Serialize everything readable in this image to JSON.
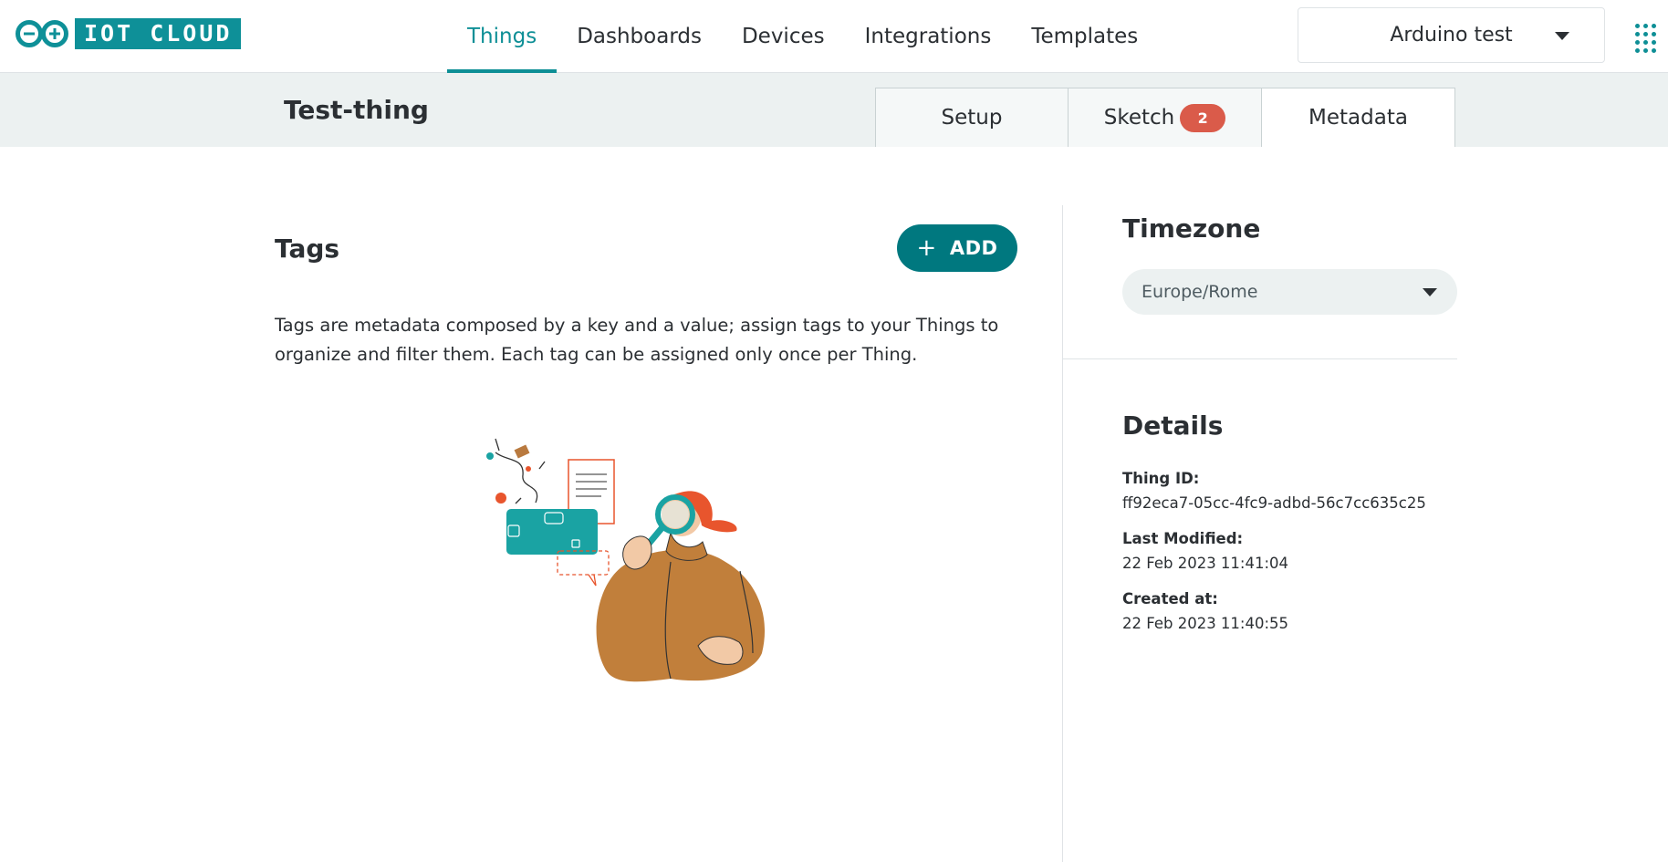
{
  "brand": {
    "name": "IOT CLOUD",
    "logo_icon": "arduino-infinity-icon",
    "color": "#0e9098"
  },
  "nav": {
    "items": [
      {
        "label": "Things",
        "active": true
      },
      {
        "label": "Dashboards",
        "active": false
      },
      {
        "label": "Devices",
        "active": false
      },
      {
        "label": "Integrations",
        "active": false
      },
      {
        "label": "Templates",
        "active": false
      }
    ],
    "accent": "#0e8f96"
  },
  "space_selector": {
    "value": "Arduino test",
    "icon": "chevron-down-icon"
  },
  "apps_menu_icon": "app-grid-icon",
  "thing": {
    "title": "Test-thing"
  },
  "tabs": [
    {
      "label": "Setup",
      "active": false
    },
    {
      "label": "Sketch",
      "active": false,
      "badge": "2"
    },
    {
      "label": "Metadata",
      "active": true
    }
  ],
  "tags": {
    "title": "Tags",
    "add_label": "ADD",
    "add_icon": "plus-icon",
    "description": "Tags are metadata composed by a key and a value; assign tags to your Things to organize and filter them. Each tag can be assigned only once per Thing.",
    "illustration": "person-with-magnifier-illustration"
  },
  "timezone": {
    "title": "Timezone",
    "value": "Europe/Rome"
  },
  "details": {
    "title": "Details",
    "thing_id_label": "Thing ID:",
    "thing_id": "ff92eca7-05cc-4fc9-adbd-56c7cc635c25",
    "last_modified_label": "Last Modified:",
    "last_modified": "22 Feb 2023 11:41:04",
    "created_label": "Created at:",
    "created": "22 Feb 2023 11:40:55"
  },
  "colors": {
    "badge": "#da5b4a",
    "add_button": "#00787f",
    "subheader_bg": "#ecf1f1"
  }
}
